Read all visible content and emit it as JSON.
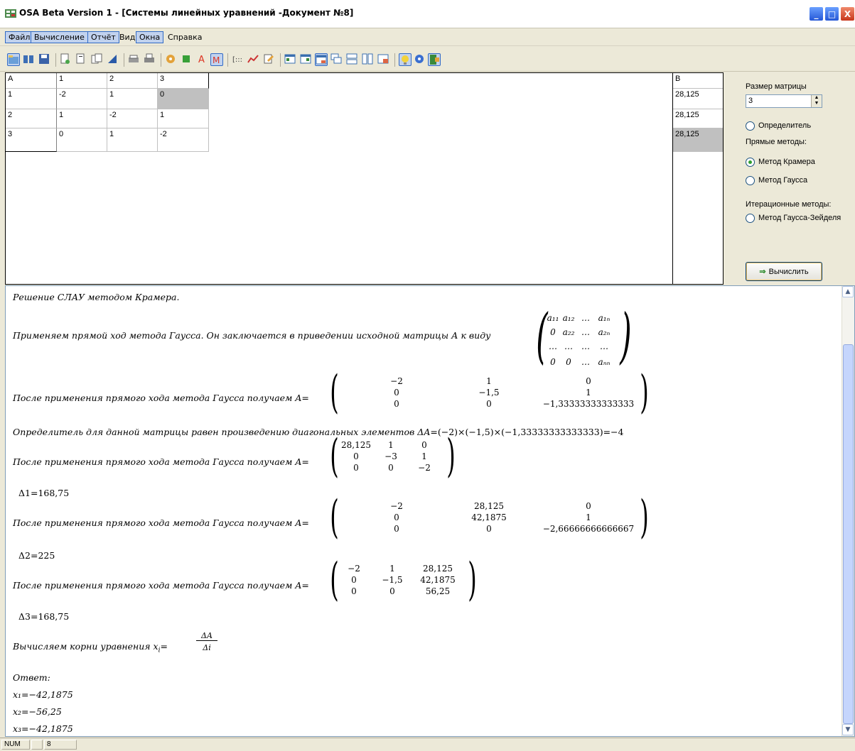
{
  "window": {
    "title": "OSA Beta Version 1 - [Системы линейных уравнений -Документ №8]",
    "min_label": "_",
    "max_label": "□",
    "close_label": "X"
  },
  "menu": [
    {
      "label": "Файл",
      "highlighted": true
    },
    {
      "label": "Вычисление",
      "highlighted": true
    },
    {
      "label": "Отчёт",
      "highlighted": true
    },
    {
      "label": "Вид",
      "highlighted": false
    },
    {
      "label": "Окна",
      "highlighted": true
    },
    {
      "label": "Справка",
      "highlighted": false
    }
  ],
  "toolbar_icons": [
    "open-icon",
    "book-icon",
    "save-icon",
    "new-icon",
    "copy-icon",
    "paste-icon",
    "tool-icon",
    "print-preview-icon",
    "print-icon",
    "settings-icon",
    "puzzle-icon",
    "font-icon",
    "formula-icon",
    "matrix-icon",
    "graph-icon",
    "edit-icon",
    "window1-icon",
    "window2-icon",
    "window3-icon",
    "cascade-icon",
    "tile-h-icon",
    "tile-v-icon",
    "arrange-icon",
    "bulb-icon",
    "help-icon",
    "exit-icon"
  ],
  "matrix": {
    "corner": "A",
    "col_headers": [
      "1",
      "2",
      "3"
    ],
    "row_headers": [
      "1",
      "2",
      "3"
    ],
    "rows": [
      [
        "-2",
        "1",
        "0"
      ],
      [
        "1",
        "-2",
        "1"
      ],
      [
        "0",
        "1",
        "-2"
      ]
    ],
    "b_header": "B",
    "b_values": [
      "28,125",
      "28,125",
      "28,125"
    ]
  },
  "panel": {
    "size_label": "Размер матрицы",
    "size_value": "3",
    "determinant_label": "Определитель",
    "direct_label": "Прямые методы:",
    "cramer_label": "Метод Крамера",
    "gauss_label": "Метод Гаусса",
    "iter_label": "Итерационные методы:",
    "seidel_label": "Метод Гаусса-Зейделя",
    "calc_button": "Вычислить",
    "selected_method": "Метод Крамера"
  },
  "report": {
    "heading": "Решение СЛАУ методом Крамера.",
    "forward_text": "Применяем прямой ход метода Гаусса. Он заключается в приведении исходной матрицы А к виду",
    "generic_matrix": [
      [
        "a₁₁",
        "a₁₂",
        "…",
        "a₁ₙ"
      ],
      [
        "0",
        "a₂₂",
        "…",
        "a₂ₙ"
      ],
      [
        "…",
        "…",
        "…",
        "…"
      ],
      [
        "0",
        "0",
        "…",
        "aₙₙ"
      ]
    ],
    "after_text": "После применения прямого хода метода Гаусса получаем A=",
    "matrix_main": [
      [
        "−2",
        "1",
        "0"
      ],
      [
        "0",
        "−1,5",
        "1"
      ],
      [
        "0",
        "0",
        "−1,33333333333333"
      ]
    ],
    "det_text": "Определитель для данной матрицы равен произведению диагональных элементов ΔA=",
    "det_formula": "(−2)×(−1,5)×(−1,33333333333333)=−4",
    "matrix_d1": [
      [
        "28,125",
        "1",
        "0"
      ],
      [
        "0",
        "−3",
        "1"
      ],
      [
        "0",
        "0",
        "−2"
      ]
    ],
    "delta1": "Δ1=168,75",
    "matrix_d2": [
      [
        "−2",
        "28,125",
        "0"
      ],
      [
        "0",
        "42,1875",
        "1"
      ],
      [
        "0",
        "0",
        "−2,66666666666667"
      ]
    ],
    "delta2": "Δ2=225",
    "matrix_d3": [
      [
        "−2",
        "1",
        "28,125"
      ],
      [
        "0",
        "−1,5",
        "42,1875"
      ],
      [
        "0",
        "0",
        "56,25"
      ]
    ],
    "delta3": "Δ3=168,75",
    "roots_text": "Вычисляем корни уравнения x",
    "roots_sub": "i",
    "roots_num": "ΔA",
    "roots_den": "Δi",
    "answer_label": "Ответ:",
    "answers": [
      "x₁=−42,1875",
      "x₂=−56,25",
      "x₃=−42,1875"
    ]
  },
  "status": {
    "num": "NUM",
    "doc": "8"
  }
}
